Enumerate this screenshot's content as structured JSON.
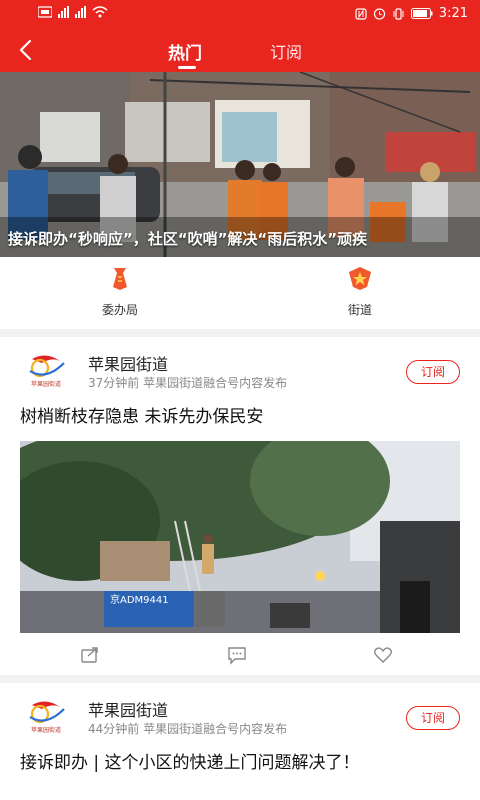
{
  "status_bar": {
    "time": "3:21"
  },
  "nav": {
    "back_icon": "chevron-left-icon",
    "tab_hot": "热门",
    "tab_subscribe": "订阅",
    "accent": "#e8251f"
  },
  "banner": {
    "title": "接诉即办“秒响应”，社区“吹哨”解决“雨后积水”顽疾"
  },
  "quick_links": [
    {
      "label": "委办局",
      "icon": "government-bureau-icon"
    },
    {
      "label": "街道",
      "icon": "street-office-icon"
    }
  ],
  "feed": [
    {
      "author": "苹果园街道",
      "meta": "37分钟前  苹果园街道融合号内容发布",
      "follow": "订阅",
      "logo_text": "苹果园街道",
      "headline": "树梢断枝存隐患 未诉先办保民安",
      "plate": "京ADM9441"
    },
    {
      "author": "苹果园街道",
      "meta": "44分钟前  苹果园街道融合号内容发布",
      "follow": "订阅",
      "logo_text": "苹果园街道",
      "headline": "接诉即办 | 这个小区的快递上门问题解决了！"
    }
  ]
}
